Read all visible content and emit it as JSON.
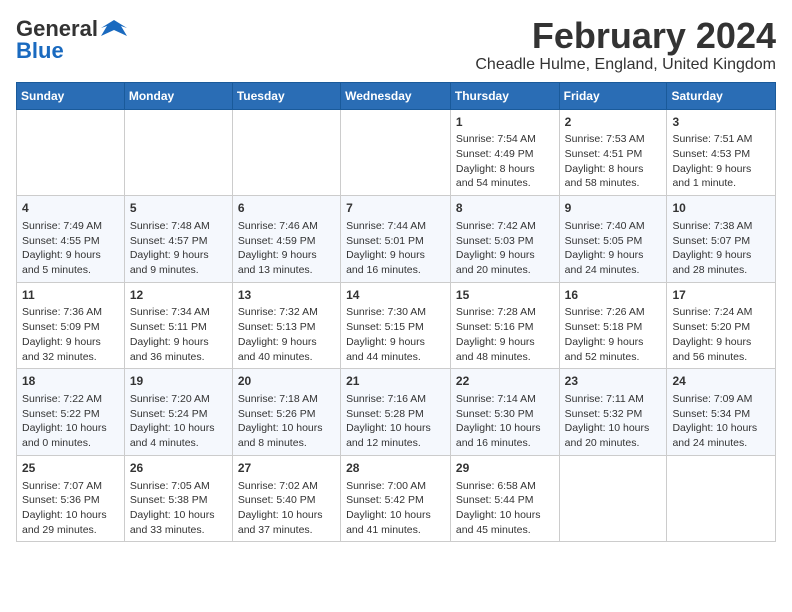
{
  "header": {
    "logo_general": "General",
    "logo_blue": "Blue",
    "month": "February 2024",
    "location": "Cheadle Hulme, England, United Kingdom"
  },
  "days_of_week": [
    "Sunday",
    "Monday",
    "Tuesday",
    "Wednesday",
    "Thursday",
    "Friday",
    "Saturday"
  ],
  "weeks": [
    [
      {
        "day": "",
        "info": ""
      },
      {
        "day": "",
        "info": ""
      },
      {
        "day": "",
        "info": ""
      },
      {
        "day": "",
        "info": ""
      },
      {
        "day": "1",
        "info": "Sunrise: 7:54 AM\nSunset: 4:49 PM\nDaylight: 8 hours and 54 minutes."
      },
      {
        "day": "2",
        "info": "Sunrise: 7:53 AM\nSunset: 4:51 PM\nDaylight: 8 hours and 58 minutes."
      },
      {
        "day": "3",
        "info": "Sunrise: 7:51 AM\nSunset: 4:53 PM\nDaylight: 9 hours and 1 minute."
      }
    ],
    [
      {
        "day": "4",
        "info": "Sunrise: 7:49 AM\nSunset: 4:55 PM\nDaylight: 9 hours and 5 minutes."
      },
      {
        "day": "5",
        "info": "Sunrise: 7:48 AM\nSunset: 4:57 PM\nDaylight: 9 hours and 9 minutes."
      },
      {
        "day": "6",
        "info": "Sunrise: 7:46 AM\nSunset: 4:59 PM\nDaylight: 9 hours and 13 minutes."
      },
      {
        "day": "7",
        "info": "Sunrise: 7:44 AM\nSunset: 5:01 PM\nDaylight: 9 hours and 16 minutes."
      },
      {
        "day": "8",
        "info": "Sunrise: 7:42 AM\nSunset: 5:03 PM\nDaylight: 9 hours and 20 minutes."
      },
      {
        "day": "9",
        "info": "Sunrise: 7:40 AM\nSunset: 5:05 PM\nDaylight: 9 hours and 24 minutes."
      },
      {
        "day": "10",
        "info": "Sunrise: 7:38 AM\nSunset: 5:07 PM\nDaylight: 9 hours and 28 minutes."
      }
    ],
    [
      {
        "day": "11",
        "info": "Sunrise: 7:36 AM\nSunset: 5:09 PM\nDaylight: 9 hours and 32 minutes."
      },
      {
        "day": "12",
        "info": "Sunrise: 7:34 AM\nSunset: 5:11 PM\nDaylight: 9 hours and 36 minutes."
      },
      {
        "day": "13",
        "info": "Sunrise: 7:32 AM\nSunset: 5:13 PM\nDaylight: 9 hours and 40 minutes."
      },
      {
        "day": "14",
        "info": "Sunrise: 7:30 AM\nSunset: 5:15 PM\nDaylight: 9 hours and 44 minutes."
      },
      {
        "day": "15",
        "info": "Sunrise: 7:28 AM\nSunset: 5:16 PM\nDaylight: 9 hours and 48 minutes."
      },
      {
        "day": "16",
        "info": "Sunrise: 7:26 AM\nSunset: 5:18 PM\nDaylight: 9 hours and 52 minutes."
      },
      {
        "day": "17",
        "info": "Sunrise: 7:24 AM\nSunset: 5:20 PM\nDaylight: 9 hours and 56 minutes."
      }
    ],
    [
      {
        "day": "18",
        "info": "Sunrise: 7:22 AM\nSunset: 5:22 PM\nDaylight: 10 hours and 0 minutes."
      },
      {
        "day": "19",
        "info": "Sunrise: 7:20 AM\nSunset: 5:24 PM\nDaylight: 10 hours and 4 minutes."
      },
      {
        "day": "20",
        "info": "Sunrise: 7:18 AM\nSunset: 5:26 PM\nDaylight: 10 hours and 8 minutes."
      },
      {
        "day": "21",
        "info": "Sunrise: 7:16 AM\nSunset: 5:28 PM\nDaylight: 10 hours and 12 minutes."
      },
      {
        "day": "22",
        "info": "Sunrise: 7:14 AM\nSunset: 5:30 PM\nDaylight: 10 hours and 16 minutes."
      },
      {
        "day": "23",
        "info": "Sunrise: 7:11 AM\nSunset: 5:32 PM\nDaylight: 10 hours and 20 minutes."
      },
      {
        "day": "24",
        "info": "Sunrise: 7:09 AM\nSunset: 5:34 PM\nDaylight: 10 hours and 24 minutes."
      }
    ],
    [
      {
        "day": "25",
        "info": "Sunrise: 7:07 AM\nSunset: 5:36 PM\nDaylight: 10 hours and 29 minutes."
      },
      {
        "day": "26",
        "info": "Sunrise: 7:05 AM\nSunset: 5:38 PM\nDaylight: 10 hours and 33 minutes."
      },
      {
        "day": "27",
        "info": "Sunrise: 7:02 AM\nSunset: 5:40 PM\nDaylight: 10 hours and 37 minutes."
      },
      {
        "day": "28",
        "info": "Sunrise: 7:00 AM\nSunset: 5:42 PM\nDaylight: 10 hours and 41 minutes."
      },
      {
        "day": "29",
        "info": "Sunrise: 6:58 AM\nSunset: 5:44 PM\nDaylight: 10 hours and 45 minutes."
      },
      {
        "day": "",
        "info": ""
      },
      {
        "day": "",
        "info": ""
      }
    ]
  ]
}
